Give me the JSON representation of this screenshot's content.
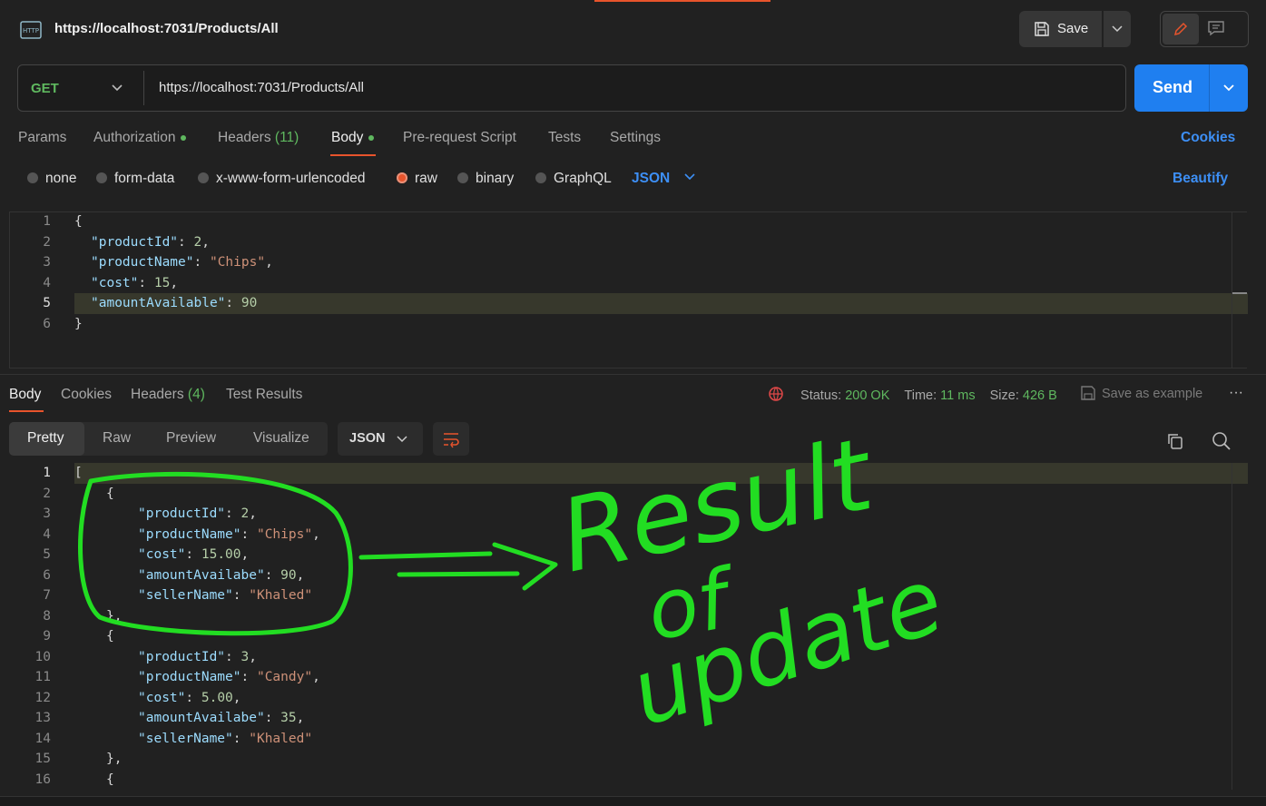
{
  "tab": {
    "title": "https://localhost:7031/Products/All",
    "icon": "http-icon"
  },
  "toolbar": {
    "save_label": "Save"
  },
  "request": {
    "method": "GET",
    "url": "https://localhost:7031/Products/All",
    "send_label": "Send",
    "tabs": [
      {
        "label": "Params"
      },
      {
        "label": "Authorization"
      },
      {
        "label": "Headers",
        "count": "(11)"
      },
      {
        "label": "Body",
        "active": true
      },
      {
        "label": "Pre-request Script"
      },
      {
        "label": "Tests"
      },
      {
        "label": "Settings"
      }
    ],
    "cookies_label": "Cookies",
    "body_types": [
      "none",
      "form-data",
      "x-www-form-urlencoded",
      "raw",
      "binary",
      "GraphQL"
    ],
    "selected_body_type": "raw",
    "format": "JSON",
    "beautify_label": "Beautify",
    "body_lines": [
      {
        "n": "1",
        "text": "{"
      },
      {
        "n": "2",
        "text": "\"productId\": 2,"
      },
      {
        "n": "3",
        "text": "\"productName\": \"Chips\","
      },
      {
        "n": "4",
        "text": "\"cost\": 15,"
      },
      {
        "n": "5",
        "text": "\"amountAvailable\": 90"
      },
      {
        "n": "6",
        "text": "}"
      }
    ]
  },
  "response": {
    "tabs": [
      {
        "label": "Body",
        "active": true
      },
      {
        "label": "Cookies"
      },
      {
        "label": "Headers",
        "count": "(4)"
      },
      {
        "label": "Test Results"
      }
    ],
    "status_label": "Status:",
    "status_value": "200 OK",
    "time_label": "Time:",
    "time_value": "11 ms",
    "size_label": "Size:",
    "size_value": "426 B",
    "save_example_label": "Save as example",
    "more_label": "···",
    "views": [
      "Pretty",
      "Raw",
      "Preview",
      "Visualize"
    ],
    "format": "JSON",
    "lines": [
      {
        "n": "1",
        "text": "["
      },
      {
        "n": "2",
        "text": "{"
      },
      {
        "n": "3",
        "text": "\"productId\": 2,"
      },
      {
        "n": "4",
        "text": "\"productName\": \"Chips\","
      },
      {
        "n": "5",
        "text": "\"cost\": 15.00,"
      },
      {
        "n": "6",
        "text": "\"amountAvailabe\": 90,"
      },
      {
        "n": "7",
        "text": "\"sellerName\": \"Khaled\""
      },
      {
        "n": "8",
        "text": "},"
      },
      {
        "n": "9",
        "text": "{"
      },
      {
        "n": "10",
        "text": "\"productId\": 3,"
      },
      {
        "n": "11",
        "text": "\"productName\": \"Candy\","
      },
      {
        "n": "12",
        "text": "\"cost\": 5.00,"
      },
      {
        "n": "13",
        "text": "\"amountAvailabe\": 35,"
      },
      {
        "n": "14",
        "text": "\"sellerName\": \"Khaled\""
      },
      {
        "n": "15",
        "text": "},"
      },
      {
        "n": "16",
        "text": "{"
      }
    ]
  },
  "annotation": {
    "text_lines": [
      "Result",
      "of",
      "update"
    ],
    "color": "#22dd22"
  },
  "colors": {
    "accent": "#e8542c",
    "send": "#1f7ff0",
    "link": "#3d8ff5",
    "success": "#5fb85f"
  }
}
